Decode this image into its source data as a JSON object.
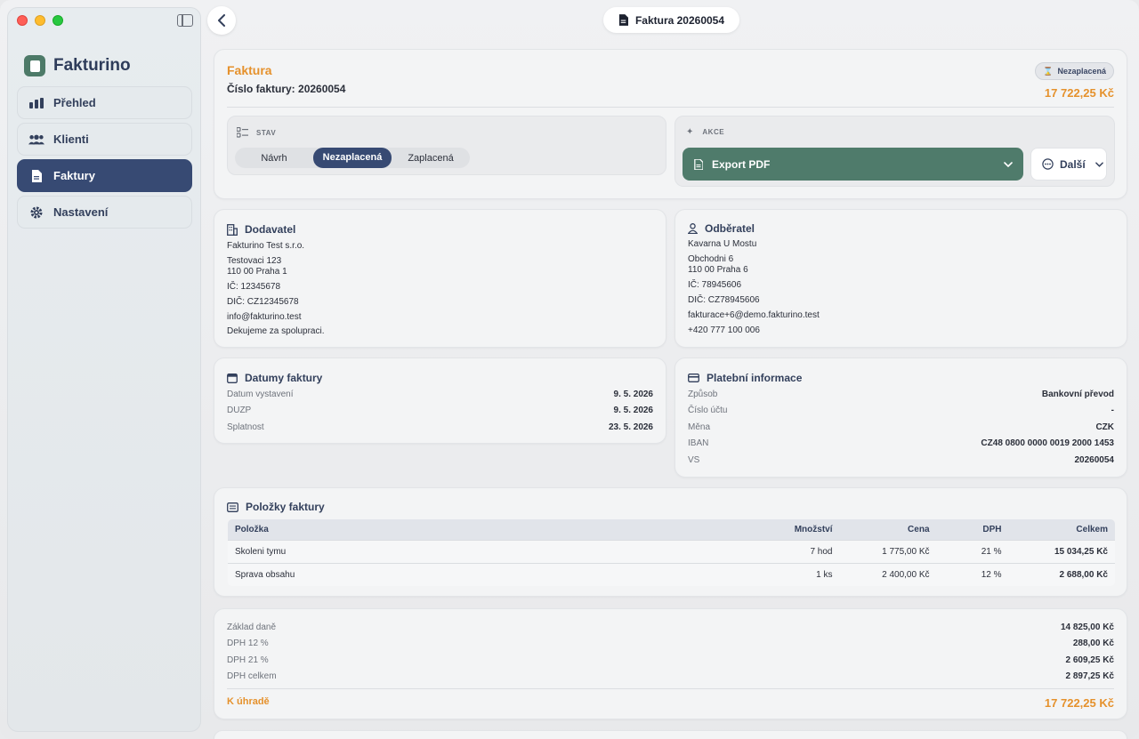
{
  "app": {
    "name": "Fakturino"
  },
  "window_title": "Faktura 20260054",
  "sidebar": {
    "items": [
      {
        "label": "Přehled",
        "icon": "chart-icon"
      },
      {
        "label": "Klienti",
        "icon": "users-icon"
      },
      {
        "label": "Faktury",
        "icon": "document-icon",
        "active": true
      },
      {
        "label": "Nastavení",
        "icon": "gear-icon"
      }
    ]
  },
  "header": {
    "title": "Faktura",
    "number_label": "Číslo faktury: 20260054",
    "status_badge": "Nezaplacená",
    "total": "17 722,25 Kč"
  },
  "stav": {
    "label": "STAV",
    "options": [
      "Návrh",
      "Nezaplacená",
      "Zaplacená"
    ],
    "selected": "Nezaplacená"
  },
  "akce": {
    "label": "AKCE",
    "export_label": "Export PDF",
    "more_label": "Další"
  },
  "supplier": {
    "title": "Dodavatel",
    "name": "Fakturino Test s.r.o.",
    "street": "Testovaci 123",
    "city": "110 00 Praha 1",
    "ic": "IČ: 12345678",
    "dic": "DIČ: CZ12345678",
    "email": "info@fakturino.test",
    "note": "Dekujeme za spolupraci."
  },
  "customer": {
    "title": "Odběratel",
    "name": "Kavarna U Mostu",
    "street": "Obchodni 6",
    "city": "110 00 Praha 6",
    "ic": "IČ: 78945606",
    "dic": "DIČ: CZ78945606",
    "email": "fakturace+6@demo.fakturino.test",
    "phone": "+420 777 100 006"
  },
  "dates": {
    "title": "Datumy faktury",
    "rows": [
      {
        "label": "Datum vystavení",
        "value": "9. 5. 2026"
      },
      {
        "label": "DUZP",
        "value": "9. 5. 2026"
      },
      {
        "label": "Splatnost",
        "value": "23. 5. 2026"
      }
    ]
  },
  "payment": {
    "title": "Platební informace",
    "rows": [
      {
        "label": "Způsob",
        "value": "Bankovní převod"
      },
      {
        "label": "Číslo účtu",
        "value": "-"
      },
      {
        "label": "Měna",
        "value": "CZK"
      },
      {
        "label": "IBAN",
        "value": "CZ48 0800 0000 0019 2000 1453"
      },
      {
        "label": "VS",
        "value": "20260054"
      }
    ]
  },
  "items": {
    "title": "Položky faktury",
    "columns": [
      "Položka",
      "Množství",
      "Cena",
      "DPH",
      "Celkem"
    ],
    "rows": [
      [
        "Skoleni tymu",
        "7 hod",
        "1 775,00 Kč",
        "21 %",
        "15 034,25 Kč"
      ],
      [
        "Sprava obsahu",
        "1 ks",
        "2 400,00 Kč",
        "12 %",
        "2 688,00 Kč"
      ]
    ]
  },
  "summary": {
    "rows": [
      {
        "label": "Základ daně",
        "value": "14 825,00 Kč"
      },
      {
        "label": "DPH 12 %",
        "value": "288,00 Kč"
      },
      {
        "label": "DPH 21 %",
        "value": "2 609,25 Kč"
      },
      {
        "label": "DPH celkem",
        "value": "2 897,25 Kč"
      }
    ],
    "total_label": "K úhradě",
    "total_value": "17 722,25 Kč"
  },
  "colors": {
    "accent": "#374a73",
    "brand_green": "#4f7b6b",
    "orange": "#e5912c"
  }
}
